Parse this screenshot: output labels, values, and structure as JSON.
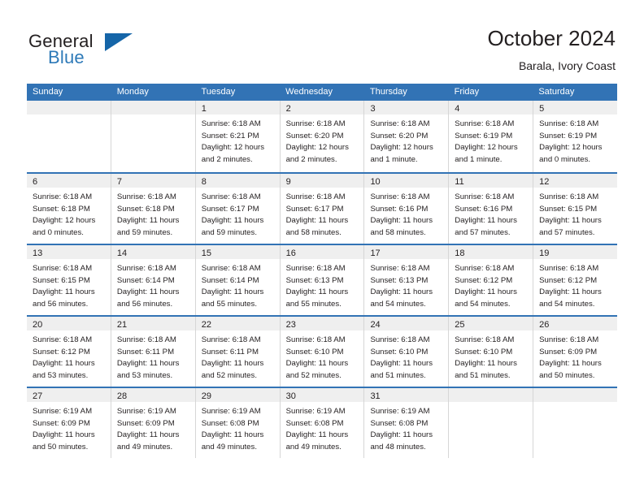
{
  "brand": {
    "name_part1": "General",
    "name_part2": "Blue",
    "triangle_color": "#1565a8",
    "blue_text_color": "#2e7ab8"
  },
  "header": {
    "title": "October 2024",
    "subtitle": "Barala, Ivory Coast"
  },
  "theme": {
    "header_blue": "#3273b5",
    "daynum_band": "#efefef",
    "cell_border": "#d6d6d6",
    "text": "#231f20"
  },
  "weekdays": [
    "Sunday",
    "Monday",
    "Tuesday",
    "Wednesday",
    "Thursday",
    "Friday",
    "Saturday"
  ],
  "weeks": [
    {
      "days": [
        {
          "day": "",
          "empty": true,
          "sunrise": "",
          "sunset": "",
          "daylight1": "",
          "daylight2": ""
        },
        {
          "day": "",
          "empty": true,
          "sunrise": "",
          "sunset": "",
          "daylight1": "",
          "daylight2": ""
        },
        {
          "day": "1",
          "empty": false,
          "sunrise": "Sunrise: 6:18 AM",
          "sunset": "Sunset: 6:21 PM",
          "daylight1": "Daylight: 12 hours",
          "daylight2": "and 2 minutes."
        },
        {
          "day": "2",
          "empty": false,
          "sunrise": "Sunrise: 6:18 AM",
          "sunset": "Sunset: 6:20 PM",
          "daylight1": "Daylight: 12 hours",
          "daylight2": "and 2 minutes."
        },
        {
          "day": "3",
          "empty": false,
          "sunrise": "Sunrise: 6:18 AM",
          "sunset": "Sunset: 6:20 PM",
          "daylight1": "Daylight: 12 hours",
          "daylight2": "and 1 minute."
        },
        {
          "day": "4",
          "empty": false,
          "sunrise": "Sunrise: 6:18 AM",
          "sunset": "Sunset: 6:19 PM",
          "daylight1": "Daylight: 12 hours",
          "daylight2": "and 1 minute."
        },
        {
          "day": "5",
          "empty": false,
          "sunrise": "Sunrise: 6:18 AM",
          "sunset": "Sunset: 6:19 PM",
          "daylight1": "Daylight: 12 hours",
          "daylight2": "and 0 minutes."
        }
      ]
    },
    {
      "days": [
        {
          "day": "6",
          "empty": false,
          "sunrise": "Sunrise: 6:18 AM",
          "sunset": "Sunset: 6:18 PM",
          "daylight1": "Daylight: 12 hours",
          "daylight2": "and 0 minutes."
        },
        {
          "day": "7",
          "empty": false,
          "sunrise": "Sunrise: 6:18 AM",
          "sunset": "Sunset: 6:18 PM",
          "daylight1": "Daylight: 11 hours",
          "daylight2": "and 59 minutes."
        },
        {
          "day": "8",
          "empty": false,
          "sunrise": "Sunrise: 6:18 AM",
          "sunset": "Sunset: 6:17 PM",
          "daylight1": "Daylight: 11 hours",
          "daylight2": "and 59 minutes."
        },
        {
          "day": "9",
          "empty": false,
          "sunrise": "Sunrise: 6:18 AM",
          "sunset": "Sunset: 6:17 PM",
          "daylight1": "Daylight: 11 hours",
          "daylight2": "and 58 minutes."
        },
        {
          "day": "10",
          "empty": false,
          "sunrise": "Sunrise: 6:18 AM",
          "sunset": "Sunset: 6:16 PM",
          "daylight1": "Daylight: 11 hours",
          "daylight2": "and 58 minutes."
        },
        {
          "day": "11",
          "empty": false,
          "sunrise": "Sunrise: 6:18 AM",
          "sunset": "Sunset: 6:16 PM",
          "daylight1": "Daylight: 11 hours",
          "daylight2": "and 57 minutes."
        },
        {
          "day": "12",
          "empty": false,
          "sunrise": "Sunrise: 6:18 AM",
          "sunset": "Sunset: 6:15 PM",
          "daylight1": "Daylight: 11 hours",
          "daylight2": "and 57 minutes."
        }
      ]
    },
    {
      "days": [
        {
          "day": "13",
          "empty": false,
          "sunrise": "Sunrise: 6:18 AM",
          "sunset": "Sunset: 6:15 PM",
          "daylight1": "Daylight: 11 hours",
          "daylight2": "and 56 minutes."
        },
        {
          "day": "14",
          "empty": false,
          "sunrise": "Sunrise: 6:18 AM",
          "sunset": "Sunset: 6:14 PM",
          "daylight1": "Daylight: 11 hours",
          "daylight2": "and 56 minutes."
        },
        {
          "day": "15",
          "empty": false,
          "sunrise": "Sunrise: 6:18 AM",
          "sunset": "Sunset: 6:14 PM",
          "daylight1": "Daylight: 11 hours",
          "daylight2": "and 55 minutes."
        },
        {
          "day": "16",
          "empty": false,
          "sunrise": "Sunrise: 6:18 AM",
          "sunset": "Sunset: 6:13 PM",
          "daylight1": "Daylight: 11 hours",
          "daylight2": "and 55 minutes."
        },
        {
          "day": "17",
          "empty": false,
          "sunrise": "Sunrise: 6:18 AM",
          "sunset": "Sunset: 6:13 PM",
          "daylight1": "Daylight: 11 hours",
          "daylight2": "and 54 minutes."
        },
        {
          "day": "18",
          "empty": false,
          "sunrise": "Sunrise: 6:18 AM",
          "sunset": "Sunset: 6:12 PM",
          "daylight1": "Daylight: 11 hours",
          "daylight2": "and 54 minutes."
        },
        {
          "day": "19",
          "empty": false,
          "sunrise": "Sunrise: 6:18 AM",
          "sunset": "Sunset: 6:12 PM",
          "daylight1": "Daylight: 11 hours",
          "daylight2": "and 54 minutes."
        }
      ]
    },
    {
      "days": [
        {
          "day": "20",
          "empty": false,
          "sunrise": "Sunrise: 6:18 AM",
          "sunset": "Sunset: 6:12 PM",
          "daylight1": "Daylight: 11 hours",
          "daylight2": "and 53 minutes."
        },
        {
          "day": "21",
          "empty": false,
          "sunrise": "Sunrise: 6:18 AM",
          "sunset": "Sunset: 6:11 PM",
          "daylight1": "Daylight: 11 hours",
          "daylight2": "and 53 minutes."
        },
        {
          "day": "22",
          "empty": false,
          "sunrise": "Sunrise: 6:18 AM",
          "sunset": "Sunset: 6:11 PM",
          "daylight1": "Daylight: 11 hours",
          "daylight2": "and 52 minutes."
        },
        {
          "day": "23",
          "empty": false,
          "sunrise": "Sunrise: 6:18 AM",
          "sunset": "Sunset: 6:10 PM",
          "daylight1": "Daylight: 11 hours",
          "daylight2": "and 52 minutes."
        },
        {
          "day": "24",
          "empty": false,
          "sunrise": "Sunrise: 6:18 AM",
          "sunset": "Sunset: 6:10 PM",
          "daylight1": "Daylight: 11 hours",
          "daylight2": "and 51 minutes."
        },
        {
          "day": "25",
          "empty": false,
          "sunrise": "Sunrise: 6:18 AM",
          "sunset": "Sunset: 6:10 PM",
          "daylight1": "Daylight: 11 hours",
          "daylight2": "and 51 minutes."
        },
        {
          "day": "26",
          "empty": false,
          "sunrise": "Sunrise: 6:18 AM",
          "sunset": "Sunset: 6:09 PM",
          "daylight1": "Daylight: 11 hours",
          "daylight2": "and 50 minutes."
        }
      ]
    },
    {
      "days": [
        {
          "day": "27",
          "empty": false,
          "sunrise": "Sunrise: 6:19 AM",
          "sunset": "Sunset: 6:09 PM",
          "daylight1": "Daylight: 11 hours",
          "daylight2": "and 50 minutes."
        },
        {
          "day": "28",
          "empty": false,
          "sunrise": "Sunrise: 6:19 AM",
          "sunset": "Sunset: 6:09 PM",
          "daylight1": "Daylight: 11 hours",
          "daylight2": "and 49 minutes."
        },
        {
          "day": "29",
          "empty": false,
          "sunrise": "Sunrise: 6:19 AM",
          "sunset": "Sunset: 6:08 PM",
          "daylight1": "Daylight: 11 hours",
          "daylight2": "and 49 minutes."
        },
        {
          "day": "30",
          "empty": false,
          "sunrise": "Sunrise: 6:19 AM",
          "sunset": "Sunset: 6:08 PM",
          "daylight1": "Daylight: 11 hours",
          "daylight2": "and 49 minutes."
        },
        {
          "day": "31",
          "empty": false,
          "sunrise": "Sunrise: 6:19 AM",
          "sunset": "Sunset: 6:08 PM",
          "daylight1": "Daylight: 11 hours",
          "daylight2": "and 48 minutes."
        },
        {
          "day": "",
          "empty": true,
          "sunrise": "",
          "sunset": "",
          "daylight1": "",
          "daylight2": ""
        },
        {
          "day": "",
          "empty": true,
          "sunrise": "",
          "sunset": "",
          "daylight1": "",
          "daylight2": ""
        }
      ]
    }
  ]
}
